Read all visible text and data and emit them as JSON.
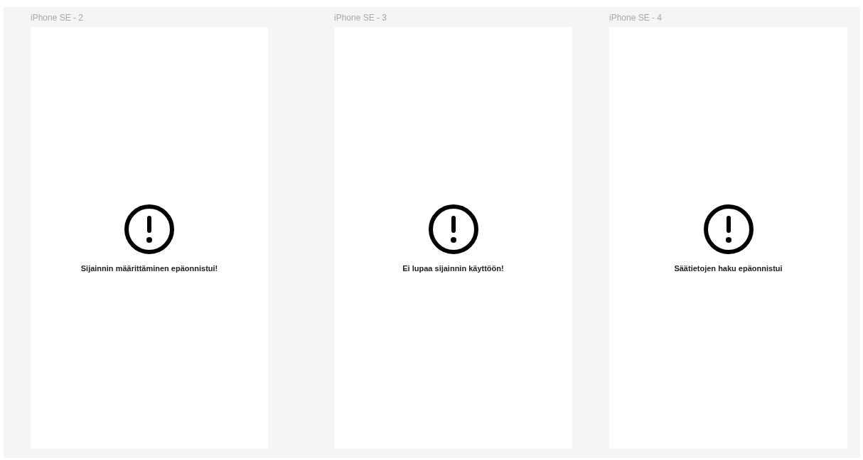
{
  "frames": [
    {
      "label": "iPhone SE - 2",
      "message": "Sijainnin määrittäminen epäonnistui!"
    },
    {
      "label": "iPhone SE - 3",
      "message": "Ei lupaa sijainnin käyttöön!"
    },
    {
      "label": "iPhone SE - 4",
      "message": "Säätietojen haku epäonnistui"
    }
  ]
}
